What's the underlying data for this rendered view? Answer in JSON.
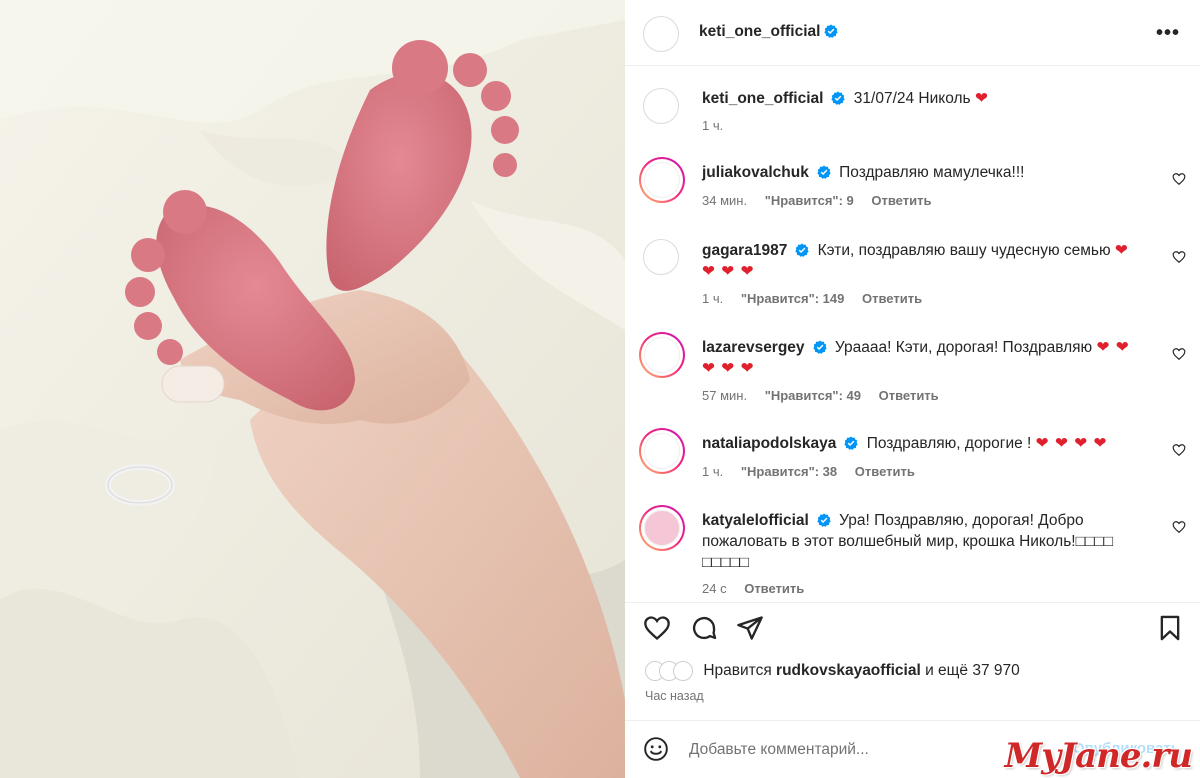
{
  "post": {
    "author": "keti_one_official",
    "caption_date": "31/07/24 Николь",
    "caption_emoji": "❤",
    "caption_time": "1 ч."
  },
  "comments": [
    {
      "user": "juliakovalchuk",
      "text": "Поздравляю мамулечка!!!",
      "hearts": "",
      "time": "34 мин.",
      "likes": "\"Нравится\": 9",
      "reply": "Ответить"
    },
    {
      "user": "gagara1987",
      "text": "Кэти, поздравляю вашу чудесную семью",
      "hearts": "❤ ❤ ❤ ❤",
      "time": "1 ч.",
      "likes": "\"Нравится\": 149",
      "reply": "Ответить"
    },
    {
      "user": "lazarevsergey",
      "text": "Ураааа! Кэти, дорогая! Поздравляю",
      "hearts": "❤ ❤ ❤ ❤ ❤",
      "time": "57 мин.",
      "likes": "\"Нравится\": 49",
      "reply": "Ответить"
    },
    {
      "user": "nataliapodolskaya",
      "text": "Поздравляю, дорогие !",
      "hearts": "❤ ❤ ❤ ❤",
      "time": "1 ч.",
      "likes": "\"Нравится\": 38",
      "reply": "Ответить"
    },
    {
      "user": "katyalelofficial",
      "text": "Ура! Поздравляю, дорогая! Добро пожаловать в этот волшебный мир, крошка Николь!□□□□ □□□□□",
      "hearts": "",
      "time": "24 с",
      "likes": "",
      "reply": "Ответить"
    }
  ],
  "likes": {
    "prefix": "Нравится",
    "user": "rudkovskayaofficial",
    "suffix": "и ещё 37 970"
  },
  "time_ago": "Час назад",
  "add_comment": {
    "placeholder": "Добавьте комментарий...",
    "post_label": "Опубликовать"
  },
  "watermark": "MyJane.ru",
  "icons": {
    "more": "more-horizontal-icon",
    "verified": "verified-badge-icon",
    "like": "heart-outline-icon",
    "comment": "comment-bubble-icon",
    "share": "paper-plane-icon",
    "save": "bookmark-icon",
    "emoji": "smiley-icon"
  },
  "colors": {
    "verified": "#0095f6",
    "heart": "#e0202c",
    "muted": "#737373",
    "watermark": "#d02828"
  }
}
